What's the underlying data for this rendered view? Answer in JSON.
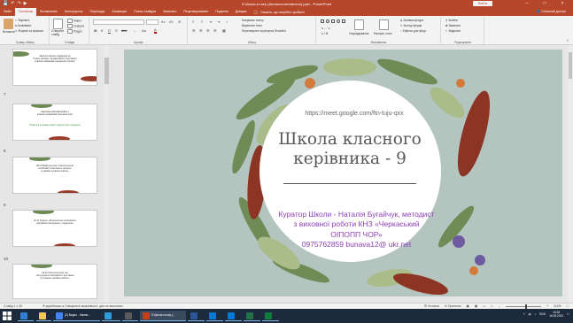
{
  "window": {
    "qat_icons": [
      "save-icon",
      "undo-icon",
      "redo-icon",
      "start-from-beginning-icon"
    ],
    "title": "9 Школа кл.кер (Автовосстановлено).pptx - PowerPoint",
    "signin": "Войти",
    "controls": [
      "–",
      "□",
      "×"
    ]
  },
  "tabs": [
    "Файл",
    "Основная",
    "Вставление",
    "Конструктор",
    "Переходы",
    "Анимация",
    "Показ слайдов",
    "Записать",
    "Рецензирование",
    "Подання",
    "Довідка"
  ],
  "active_tab": 1,
  "tell_me": "Скажіть, що потрібно зробити",
  "share": "Спільний доступ",
  "ribbon": {
    "clipboard": {
      "paste": "Вставити",
      "items": [
        "Вирізати",
        "Копіювати",
        "Формат за зразком"
      ],
      "label": "Буфер обміну"
    },
    "slides": {
      "new_slide": "Створити слайд",
      "items": [
        "Макет",
        "Скинути",
        "Розділ"
      ],
      "label": "Слайди"
    },
    "font": {
      "name": "",
      "size": "",
      "format_letters": [
        "Ж",
        "К",
        "П",
        "S",
        "abc"
      ],
      "label": "Шрифт"
    },
    "paragraph": {
      "options": [
        "Напрямок тексту",
        "Вирівняти текст",
        "Перетворити на рисунок SmartArt"
      ],
      "label": "Абзац"
    },
    "drawing": {
      "arrange": "Упорядкування",
      "quick_styles": "Експрес-стилі",
      "options": [
        "Заливка фігури",
        "Контур фігури",
        "Ефекти для фігур"
      ],
      "label": "Малювання"
    },
    "editing": {
      "items": [
        "Знайти",
        "Замінити",
        "Виділити"
      ],
      "label": "Редагування"
    }
  },
  "thumbnails": [
    {
      "number": "",
      "lines": [
        "Школа класного керівника за",
        "Плану заходів з професійного зростання",
        "класних керівників Черкаської області"
      ]
    },
    {
      "number": "7",
      "lines": [
        "Навчання кваліфікаційне з",
        "класних керівників сільських шкіл"
      ],
      "green_line": "Розвиток в умовах зміни педагогічних парадигм"
    },
    {
      "number": "8",
      "lines": [
        "08.10 Майстер-клас «Психологічна",
        "особливість виховного процесу",
        "в умовах сучасної освіти»"
      ]
    },
    {
      "number": "9",
      "lines": [
        "12.11 Тренінг «Психологічні особливості",
        "емоційного вигорання у педагогів»"
      ]
    },
    {
      "number": "10",
      "lines": [
        "03.12 Психологічний час",
        "«Інструменти емоційного зростання",
        "в сучасних умовах роботи»"
      ]
    }
  ],
  "slide": {
    "url": "https://meet.google.com/ftn-tuju-qxx",
    "title_line1": "Школа класного",
    "title_line2": "керівника - 9",
    "author_lines": [
      "Куратор Школи - Наталія Бугайчук, методист",
      "з виховної роботи КНЗ «Черкаський",
      "ОІПОПП ЧОР»",
      "0975762859 bunava12@ ukr.net"
    ]
  },
  "status": {
    "slide_counter": "Слайд 1 з 39",
    "language": "українська",
    "accessibility": "Спеціальні можливості: дію не виконано",
    "notes": "Нотатки",
    "comments": "Примітки",
    "zoom": "114%"
  },
  "taskbar": {
    "apps": [
      {
        "label": "",
        "color": "#2e7fd4"
      },
      {
        "label": "",
        "color": "#f2c94c"
      },
      {
        "label": "(2) Видео - Кампи...",
        "color": "#4285f4"
      },
      {
        "label": "",
        "color": "#2d9cdb"
      },
      {
        "label": "",
        "color": "#5a5a5a"
      },
      {
        "label": "9 Школа кл.кер (...",
        "color": "#c43e1c"
      },
      {
        "label": "",
        "color": "#2b579a"
      },
      {
        "label": "",
        "color": "#0078d4"
      },
      {
        "label": "",
        "color": "#0078d4"
      },
      {
        "label": "",
        "color": "#217346"
      },
      {
        "label": "",
        "color": "#0f7b3d"
      }
    ],
    "language": "ENG",
    "time": "16:26",
    "date": "16.09.2021"
  },
  "colors": {
    "accent": "#b7472a",
    "slide_bg": "#b4c5c0",
    "author_text": "#8e3fb6",
    "title_text": "#595959",
    "taskbar": "#1c2a3c"
  }
}
